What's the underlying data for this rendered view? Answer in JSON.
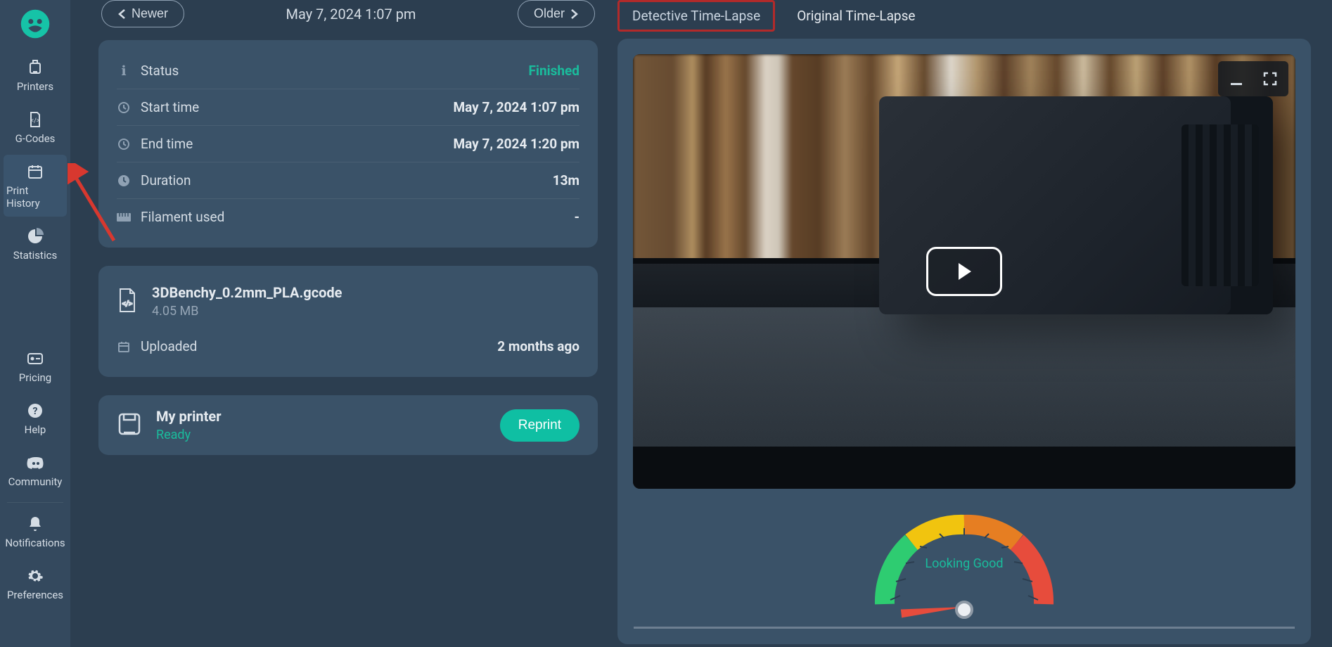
{
  "sidebar": {
    "items": [
      {
        "label": "Printers"
      },
      {
        "label": "G-Codes"
      },
      {
        "label": "Print History"
      },
      {
        "label": "Statistics"
      },
      {
        "label": "Pricing"
      },
      {
        "label": "Help"
      },
      {
        "label": "Community"
      },
      {
        "label": "Notifications"
      },
      {
        "label": "Preferences"
      }
    ]
  },
  "pager": {
    "newer": "Newer",
    "older": "Older",
    "date": "May 7, 2024 1:07 pm"
  },
  "info": {
    "status_label": "Status",
    "status_value": "Finished",
    "start_label": "Start time",
    "start_value": "May 7, 2024 1:07 pm",
    "end_label": "End time",
    "end_value": "May 7, 2024 1:20 pm",
    "duration_label": "Duration",
    "duration_value": "13m",
    "filament_label": "Filament used",
    "filament_value": "-"
  },
  "file": {
    "name": "3DBenchy_0.2mm_PLA.gcode",
    "size": "4.05 MB",
    "uploaded_label": "Uploaded",
    "uploaded_value": "2 months ago"
  },
  "printer": {
    "name": "My printer",
    "state": "Ready",
    "reprint": "Reprint"
  },
  "tabs": {
    "detective": "Detective Time-Lapse",
    "original": "Original Time-Lapse"
  },
  "gauge": {
    "label": "Looking Good"
  }
}
